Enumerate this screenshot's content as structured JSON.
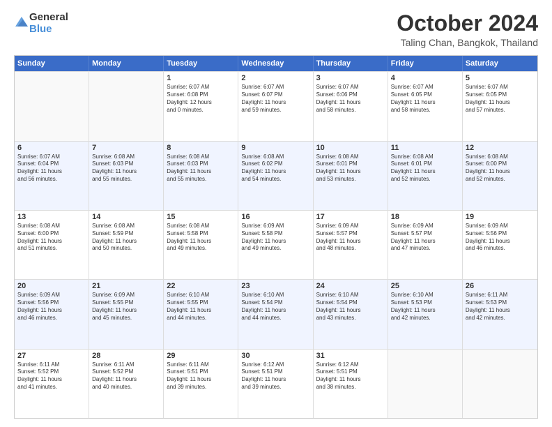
{
  "header": {
    "logo_line1": "General",
    "logo_line2": "Blue",
    "month_title": "October 2024",
    "location": "Taling Chan, Bangkok, Thailand"
  },
  "weekdays": [
    "Sunday",
    "Monday",
    "Tuesday",
    "Wednesday",
    "Thursday",
    "Friday",
    "Saturday"
  ],
  "rows": [
    {
      "alt": false,
      "cells": [
        {
          "day": "",
          "text": ""
        },
        {
          "day": "",
          "text": ""
        },
        {
          "day": "1",
          "text": "Sunrise: 6:07 AM\nSunset: 6:08 PM\nDaylight: 12 hours\nand 0 minutes."
        },
        {
          "day": "2",
          "text": "Sunrise: 6:07 AM\nSunset: 6:07 PM\nDaylight: 11 hours\nand 59 minutes."
        },
        {
          "day": "3",
          "text": "Sunrise: 6:07 AM\nSunset: 6:06 PM\nDaylight: 11 hours\nand 58 minutes."
        },
        {
          "day": "4",
          "text": "Sunrise: 6:07 AM\nSunset: 6:05 PM\nDaylight: 11 hours\nand 58 minutes."
        },
        {
          "day": "5",
          "text": "Sunrise: 6:07 AM\nSunset: 6:05 PM\nDaylight: 11 hours\nand 57 minutes."
        }
      ]
    },
    {
      "alt": true,
      "cells": [
        {
          "day": "6",
          "text": "Sunrise: 6:07 AM\nSunset: 6:04 PM\nDaylight: 11 hours\nand 56 minutes."
        },
        {
          "day": "7",
          "text": "Sunrise: 6:08 AM\nSunset: 6:03 PM\nDaylight: 11 hours\nand 55 minutes."
        },
        {
          "day": "8",
          "text": "Sunrise: 6:08 AM\nSunset: 6:03 PM\nDaylight: 11 hours\nand 55 minutes."
        },
        {
          "day": "9",
          "text": "Sunrise: 6:08 AM\nSunset: 6:02 PM\nDaylight: 11 hours\nand 54 minutes."
        },
        {
          "day": "10",
          "text": "Sunrise: 6:08 AM\nSunset: 6:01 PM\nDaylight: 11 hours\nand 53 minutes."
        },
        {
          "day": "11",
          "text": "Sunrise: 6:08 AM\nSunset: 6:01 PM\nDaylight: 11 hours\nand 52 minutes."
        },
        {
          "day": "12",
          "text": "Sunrise: 6:08 AM\nSunset: 6:00 PM\nDaylight: 11 hours\nand 52 minutes."
        }
      ]
    },
    {
      "alt": false,
      "cells": [
        {
          "day": "13",
          "text": "Sunrise: 6:08 AM\nSunset: 6:00 PM\nDaylight: 11 hours\nand 51 minutes."
        },
        {
          "day": "14",
          "text": "Sunrise: 6:08 AM\nSunset: 5:59 PM\nDaylight: 11 hours\nand 50 minutes."
        },
        {
          "day": "15",
          "text": "Sunrise: 6:08 AM\nSunset: 5:58 PM\nDaylight: 11 hours\nand 49 minutes."
        },
        {
          "day": "16",
          "text": "Sunrise: 6:09 AM\nSunset: 5:58 PM\nDaylight: 11 hours\nand 49 minutes."
        },
        {
          "day": "17",
          "text": "Sunrise: 6:09 AM\nSunset: 5:57 PM\nDaylight: 11 hours\nand 48 minutes."
        },
        {
          "day": "18",
          "text": "Sunrise: 6:09 AM\nSunset: 5:57 PM\nDaylight: 11 hours\nand 47 minutes."
        },
        {
          "day": "19",
          "text": "Sunrise: 6:09 AM\nSunset: 5:56 PM\nDaylight: 11 hours\nand 46 minutes."
        }
      ]
    },
    {
      "alt": true,
      "cells": [
        {
          "day": "20",
          "text": "Sunrise: 6:09 AM\nSunset: 5:56 PM\nDaylight: 11 hours\nand 46 minutes."
        },
        {
          "day": "21",
          "text": "Sunrise: 6:09 AM\nSunset: 5:55 PM\nDaylight: 11 hours\nand 45 minutes."
        },
        {
          "day": "22",
          "text": "Sunrise: 6:10 AM\nSunset: 5:55 PM\nDaylight: 11 hours\nand 44 minutes."
        },
        {
          "day": "23",
          "text": "Sunrise: 6:10 AM\nSunset: 5:54 PM\nDaylight: 11 hours\nand 44 minutes."
        },
        {
          "day": "24",
          "text": "Sunrise: 6:10 AM\nSunset: 5:54 PM\nDaylight: 11 hours\nand 43 minutes."
        },
        {
          "day": "25",
          "text": "Sunrise: 6:10 AM\nSunset: 5:53 PM\nDaylight: 11 hours\nand 42 minutes."
        },
        {
          "day": "26",
          "text": "Sunrise: 6:11 AM\nSunset: 5:53 PM\nDaylight: 11 hours\nand 42 minutes."
        }
      ]
    },
    {
      "alt": false,
      "cells": [
        {
          "day": "27",
          "text": "Sunrise: 6:11 AM\nSunset: 5:52 PM\nDaylight: 11 hours\nand 41 minutes."
        },
        {
          "day": "28",
          "text": "Sunrise: 6:11 AM\nSunset: 5:52 PM\nDaylight: 11 hours\nand 40 minutes."
        },
        {
          "day": "29",
          "text": "Sunrise: 6:11 AM\nSunset: 5:51 PM\nDaylight: 11 hours\nand 39 minutes."
        },
        {
          "day": "30",
          "text": "Sunrise: 6:12 AM\nSunset: 5:51 PM\nDaylight: 11 hours\nand 39 minutes."
        },
        {
          "day": "31",
          "text": "Sunrise: 6:12 AM\nSunset: 5:51 PM\nDaylight: 11 hours\nand 38 minutes."
        },
        {
          "day": "",
          "text": ""
        },
        {
          "day": "",
          "text": ""
        }
      ]
    }
  ]
}
